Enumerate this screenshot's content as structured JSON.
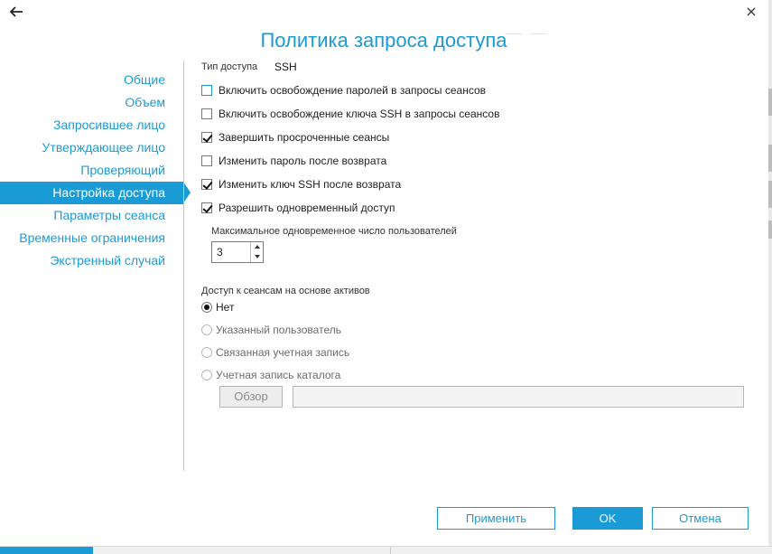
{
  "dialog": {
    "title": "Политика запроса доступа"
  },
  "nav": {
    "items": [
      {
        "label": "Общие",
        "active": false
      },
      {
        "label": "Объем",
        "active": false
      },
      {
        "label": "Запросившее лицо",
        "active": false
      },
      {
        "label": "Утверждающее лицо",
        "active": false
      },
      {
        "label": "Проверяющий",
        "active": false
      },
      {
        "label": "Настройка доступа",
        "active": true
      },
      {
        "label": "Параметры сеанса",
        "active": false
      },
      {
        "label": "Временные ограничения",
        "active": false
      },
      {
        "label": "Экстренный случай",
        "active": false
      }
    ]
  },
  "access": {
    "type_label": "Тип доступа",
    "type_value": "SSH",
    "options": [
      {
        "label": "Включить освобождение паролей в запросы сеансов",
        "checked": false
      },
      {
        "label": "Включить освобождение ключа SSH в запросы сеансов",
        "checked": false
      },
      {
        "label": "Завершить просроченные сеансы",
        "checked": true
      },
      {
        "label": "Изменить пароль после возврата",
        "checked": false
      },
      {
        "label": "Изменить ключ SSH после возврата",
        "checked": true
      },
      {
        "label": "Разрешить одновременный доступ",
        "checked": true
      }
    ],
    "max_users_label": "Максимальное одновременное число пользователей",
    "max_users_value": "3",
    "asset_based_label": "Доступ к сеансам на основе активов",
    "asset_options": [
      {
        "label": "Нет",
        "selected": true
      },
      {
        "label": "Указанный пользователь",
        "selected": false
      },
      {
        "label": "Связанная учетная запись",
        "selected": false
      },
      {
        "label": "Учетная запись каталога",
        "selected": false
      }
    ],
    "browse_label": "Обзор",
    "path_value": ""
  },
  "buttons": {
    "apply": "Применить",
    "ok": "OK",
    "cancel": "Отмена"
  },
  "colors": {
    "accent": "#1a9bd6"
  }
}
